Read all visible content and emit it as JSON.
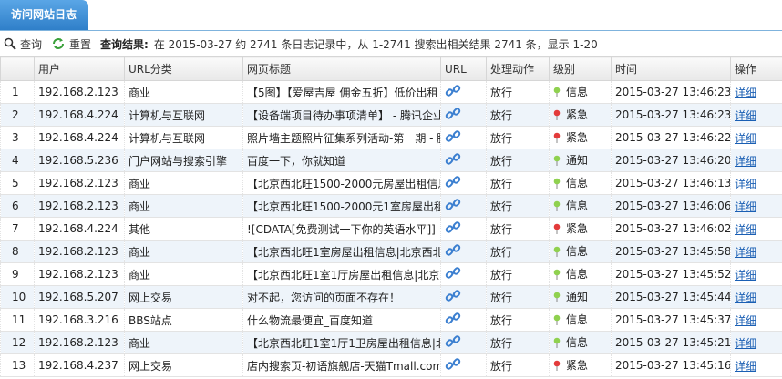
{
  "tab": {
    "label": "访问网站日志"
  },
  "toolbar": {
    "query_label": "查询",
    "reset_label": "重置",
    "result_label": "查询结果:",
    "result_text": "在 2015-03-27 约 2741 条日志记录中，从 1-2741 搜索出相关结果 2741 条，显示 1-20"
  },
  "columns": [
    "",
    "用户",
    "URL分类",
    "网页标题",
    "URL",
    "处理动作",
    "级别",
    "时间",
    "操作"
  ],
  "colors": {
    "info": "#8fd14f",
    "urgent": "#e33b3b",
    "notice": "#8fd14f",
    "link": "#1a5fb4"
  },
  "rows": [
    {
      "n": "1",
      "user": "192.168.2.123",
      "cat": "商业",
      "title": "【5图】【爱屋吉屋 佣金五折】低价出租",
      "action": "放行",
      "level": "信息",
      "level_type": "info",
      "time": "2015-03-27 13:46:23",
      "op": "详细"
    },
    {
      "n": "2",
      "user": "192.168.4.224",
      "cat": "计算机与互联网",
      "title": "【设备端项目待办事项清单】 - 腾讯企业",
      "action": "放行",
      "level": "紧急",
      "level_type": "urgent",
      "time": "2015-03-27 13:46:23",
      "op": "详细"
    },
    {
      "n": "3",
      "user": "192.168.4.224",
      "cat": "计算机与互联网",
      "title": "照片墙主题照片征集系列活动-第一期 - 腾",
      "action": "放行",
      "level": "紧急",
      "level_type": "urgent",
      "time": "2015-03-27 13:46:22",
      "op": "详细"
    },
    {
      "n": "4",
      "user": "192.168.5.236",
      "cat": "门户网站与搜索引擎",
      "title": "百度一下，你就知道",
      "action": "放行",
      "level": "通知",
      "level_type": "notice",
      "time": "2015-03-27 13:46:20",
      "op": "详细"
    },
    {
      "n": "5",
      "user": "192.168.2.123",
      "cat": "商业",
      "title": "【北京西北旺1500-2000元房屋出租信息",
      "action": "放行",
      "level": "信息",
      "level_type": "info",
      "time": "2015-03-27 13:46:13",
      "op": "详细"
    },
    {
      "n": "6",
      "user": "192.168.2.123",
      "cat": "商业",
      "title": "【北京西北旺1500-2000元1室房屋出租信",
      "action": "放行",
      "level": "信息",
      "level_type": "info",
      "time": "2015-03-27 13:46:06",
      "op": "详细"
    },
    {
      "n": "7",
      "user": "192.168.4.224",
      "cat": "其他",
      "title": "![CDATA[免费测试一下你的英语水平]]",
      "action": "放行",
      "level": "紧急",
      "level_type": "urgent",
      "time": "2015-03-27 13:46:02",
      "op": "详细"
    },
    {
      "n": "8",
      "user": "192.168.2.123",
      "cat": "商业",
      "title": "【北京西北旺1室房屋出租信息|北京西北",
      "action": "放行",
      "level": "信息",
      "level_type": "info",
      "time": "2015-03-27 13:45:58",
      "op": "详细"
    },
    {
      "n": "9",
      "user": "192.168.2.123",
      "cat": "商业",
      "title": "【北京西北旺1室1厅房屋出租信息|北京",
      "action": "放行",
      "level": "信息",
      "level_type": "info",
      "time": "2015-03-27 13:45:52",
      "op": "详细"
    },
    {
      "n": "10",
      "user": "192.168.5.207",
      "cat": "网上交易",
      "title": "对不起，您访问的页面不存在！",
      "action": "放行",
      "level": "通知",
      "level_type": "notice",
      "time": "2015-03-27 13:45:44",
      "op": "详细"
    },
    {
      "n": "11",
      "user": "192.168.3.216",
      "cat": "BBS站点",
      "title": "什么物流最便宜_百度知道",
      "action": "放行",
      "level": "信息",
      "level_type": "info",
      "time": "2015-03-27 13:45:37",
      "op": "详细"
    },
    {
      "n": "12",
      "user": "192.168.2.123",
      "cat": "商业",
      "title": "【北京西北旺1室1厅1卫房屋出租信息|北",
      "action": "放行",
      "level": "信息",
      "level_type": "info",
      "time": "2015-03-27 13:45:21",
      "op": "详细"
    },
    {
      "n": "13",
      "user": "192.168.4.237",
      "cat": "网上交易",
      "title": "店内搜索页-初语旗舰店-天猫Tmall.com",
      "action": "放行",
      "level": "紧急",
      "level_type": "urgent",
      "time": "2015-03-27 13:45:16",
      "op": "详细"
    }
  ]
}
